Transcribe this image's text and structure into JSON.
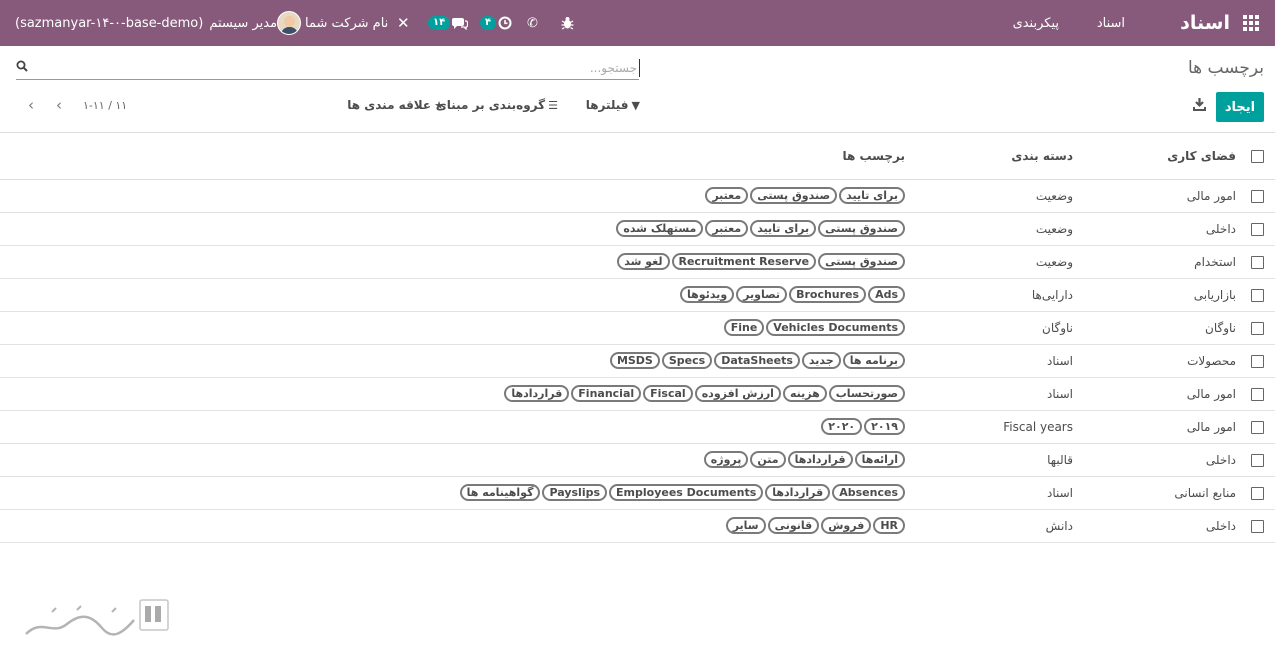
{
  "navbar": {
    "brand": "اسناد",
    "menu": [
      {
        "label": "اسناد"
      },
      {
        "label": "پیکربندی"
      }
    ],
    "user": {
      "name": "مدیر سیستم",
      "db": "(sazmanyar-۱۴-۰-base-demo)"
    },
    "company": "نام شرکت شما",
    "messages_count": "۱۴",
    "activities_count": "۴"
  },
  "breadcrumb": "برچسب ها",
  "search": {
    "placeholder": "جستجو..."
  },
  "buttons": {
    "create": "ایجاد"
  },
  "filters": {
    "filters_label": "فیلترها",
    "group_by_label": "گروه‌بندی بر مبنای",
    "favorites_label": "علاقه مندی ها"
  },
  "pager": {
    "value": "۱-۱۱ / ۱۱"
  },
  "table": {
    "headers": {
      "workspace": "فضای کاری",
      "category": "دسته بندی",
      "tags": "برچسب ها"
    },
    "rows": [
      {
        "workspace": "امور مالی",
        "category": "وضعیت",
        "tags": [
          "برای تایید",
          "صندوق پستی",
          "معتبر"
        ]
      },
      {
        "workspace": "داخلی",
        "category": "وضعیت",
        "tags": [
          "صندوق پستی",
          "برای تایید",
          "معتبر",
          "مستهلک شده"
        ]
      },
      {
        "workspace": "استخدام",
        "category": "وضعیت",
        "tags": [
          "صندوق پستی",
          "Recruitment Reserve",
          "لغو شد"
        ]
      },
      {
        "workspace": "بازاریابی",
        "category": "دارایی‌ها",
        "tags": [
          "Ads",
          "Brochures",
          "تصاویر",
          "ویدئوها"
        ]
      },
      {
        "workspace": "ناوگان",
        "category": "ناوگان",
        "tags": [
          "Vehicles Documents",
          "Fine"
        ]
      },
      {
        "workspace": "محصولات",
        "category": "اسناد",
        "tags": [
          "برنامه ها",
          "جدید",
          "DataSheets",
          "Specs",
          "MSDS"
        ]
      },
      {
        "workspace": "امور مالی",
        "category": "اسناد",
        "tags": [
          "صورتحساب",
          "هزینه",
          "ارزش افزوده",
          "Fiscal",
          "Financial",
          "قراردادها"
        ]
      },
      {
        "workspace": "امور مالی",
        "category": "Fiscal years",
        "tags": [
          "۲۰۱۹",
          "۲۰۲۰"
        ]
      },
      {
        "workspace": "داخلی",
        "category": "قالبها",
        "tags": [
          "ارائه‌ها",
          "قراردادها",
          "متن",
          "پروژه"
        ]
      },
      {
        "workspace": "منابع انسانی",
        "category": "اسناد",
        "tags": [
          "Absences",
          "قراردادها",
          "Employees Documents",
          "Payslips",
          "گواهینامه ها"
        ]
      },
      {
        "workspace": "داخلی",
        "category": "دانش",
        "tags": [
          "HR",
          "فروش",
          "قانونی",
          "سایر"
        ]
      }
    ]
  },
  "colors": {
    "navbar": "#875a7b",
    "primary": "#00a09d"
  }
}
